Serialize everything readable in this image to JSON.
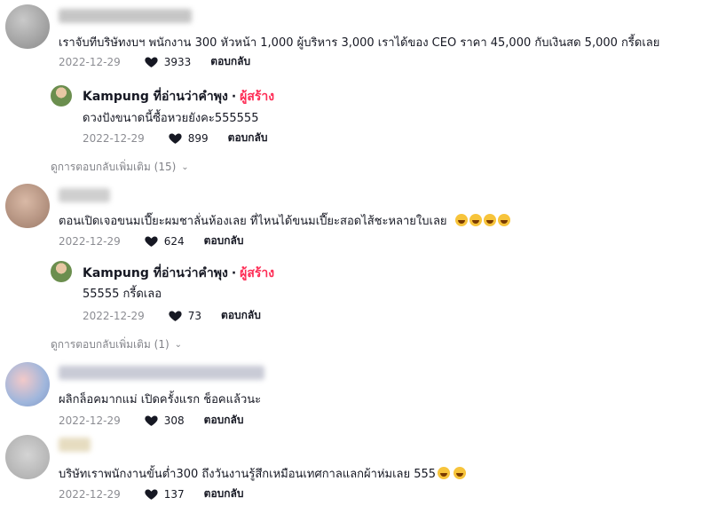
{
  "comments": [
    {
      "text": "เราจับทีบริษัทงบฯ พนักงาน 300 หัวหน้า 1,000 ผู้บริหาร 3,000 เราได้ของ CEO ราคา 45,000 กับเงินสด 5,000 กรี้ดเลย",
      "date": "2022-12-29",
      "likes": "3933",
      "reply_label": "ตอบกลับ",
      "reply": {
        "author": "Kampung ที่อ่านว่าคําพุง",
        "separator": "·",
        "badge": "ผู้สร้าง",
        "text": "ดวงปังขนาดนี้ซื้อหวยยังคะ555555",
        "date": "2022-12-29",
        "likes": "899",
        "reply_label": "ตอบกลับ"
      },
      "more_replies": "ดูการตอบกลับเพิ่มเติม (15)"
    },
    {
      "text": "ตอนเปิดเจอขนมเปี๊ยะผมชาลั่นห้องเลย ที่ไหนได้ขนมเปี๊ยะสอดไส้ชะหลายใบเลย",
      "date": "2022-12-29",
      "likes": "624",
      "reply_label": "ตอบกลับ",
      "reply": {
        "author": "Kampung ที่อ่านว่าคําพุง",
        "separator": "·",
        "badge": "ผู้สร้าง",
        "text": "55555 กรี้ดเลอ",
        "date": "2022-12-29",
        "likes": "73",
        "reply_label": "ตอบกลับ"
      },
      "more_replies": "ดูการตอบกลับเพิ่มเติม (1)"
    },
    {
      "text": "ผลิกล็อคมากแม่ เปิดครั้งแรก ช็อคแล้วนะ",
      "date": "2022-12-29",
      "likes": "308",
      "reply_label": "ตอบกลับ"
    },
    {
      "text": "บริษัทเราพนักงานขั้นต่ำ300 ถึงวันงานรู้สึกเหมือนเทศกาลแลกผ้าห่มเลย 555",
      "date": "2022-12-29",
      "likes": "137",
      "reply_label": "ตอบกลับ"
    }
  ],
  "colors": {
    "creator_badge": "#fe2c55",
    "text": "#161823",
    "muted": "rgba(22,24,35,0.5)"
  },
  "icons": {
    "like": "heart-icon",
    "expand": "chevron-down-icon",
    "laugh": "laughing-emoji"
  }
}
